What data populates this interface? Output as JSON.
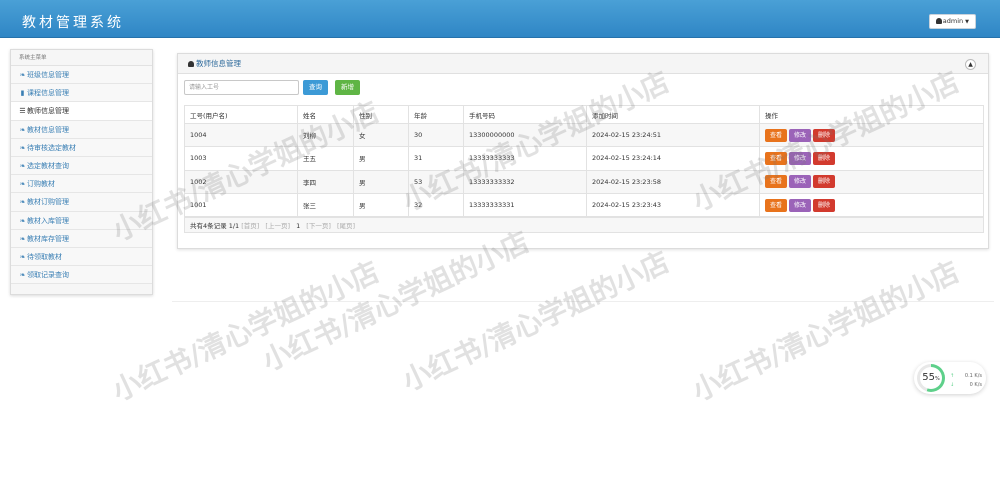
{
  "app": {
    "title": "教材管理系统",
    "user": "admin"
  },
  "sidebar": {
    "header": "系统主菜单",
    "items": [
      {
        "label": "班级信息管理",
        "icon": "leaf-icon"
      },
      {
        "label": "课程信息管理",
        "icon": "bookmark-icon"
      },
      {
        "label": "教师信息管理",
        "icon": "list-icon",
        "active": true
      },
      {
        "label": "教材信息管理",
        "icon": "leaf-icon"
      },
      {
        "label": "待审核选定教材",
        "icon": "leaf-icon"
      },
      {
        "label": "选定教材查询",
        "icon": "leaf-icon"
      },
      {
        "label": "订购教材",
        "icon": "leaf-icon"
      },
      {
        "label": "教材订购管理",
        "icon": "leaf-icon"
      },
      {
        "label": "教材入库管理",
        "icon": "leaf-icon"
      },
      {
        "label": "教材库存管理",
        "icon": "leaf-icon"
      },
      {
        "label": "待领取教材",
        "icon": "leaf-icon"
      },
      {
        "label": "领取记录查询",
        "icon": "leaf-icon"
      }
    ]
  },
  "panel": {
    "title": "教师信息管理",
    "search": {
      "placeholder": "请输入工号",
      "value": ""
    },
    "search_label": "查询",
    "new_label": "新增",
    "columns": [
      "工号(用户名)",
      "姓名",
      "性别",
      "年龄",
      "手机号码",
      "添加时间",
      "操作"
    ],
    "rows": [
      [
        "1004",
        "刘柳",
        "女",
        "30",
        "13300000000",
        "2024-02-15 23:24:51"
      ],
      [
        "1003",
        "王五",
        "男",
        "31",
        "13333333333",
        "2024-02-15 23:24:14"
      ],
      [
        "1002",
        "李四",
        "男",
        "53",
        "13333333332",
        "2024-02-15 23:23:58"
      ],
      [
        "1001",
        "张三",
        "男",
        "32",
        "13333333331",
        "2024-02-15 23:23:43"
      ]
    ],
    "actions": {
      "view": "查看",
      "edit": "修改",
      "delete": "删除"
    },
    "pager": {
      "summary": "共有4条记录 1/1",
      "first": "[首页]",
      "prev": "[上一页]",
      "current": "1",
      "next": "[下一页]",
      "last": "[尾页]"
    }
  },
  "watermark": "小红书/清心学姐的小店",
  "net_widget": {
    "percent": 55,
    "percent_text": "55",
    "percent_sign": "%",
    "up": "0.1 K/s",
    "down": "0 K/s"
  },
  "colors": {
    "topbar": "#3b93d0",
    "view_button": "#e8731c",
    "edit_button": "#9b63b8",
    "delete_button": "#d23a2e",
    "search_button": "#3c9ad6",
    "new_button": "#5fb545"
  }
}
